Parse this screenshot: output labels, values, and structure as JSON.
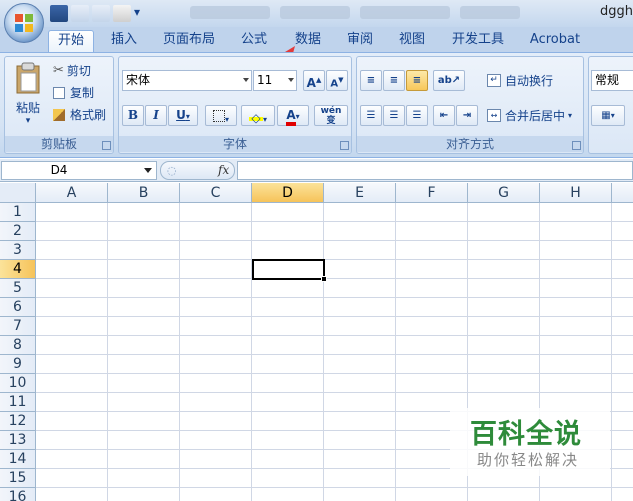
{
  "window": {
    "title_fragment": "dggh"
  },
  "tabs": [
    "开始",
    "插入",
    "页面布局",
    "公式",
    "数据",
    "审阅",
    "视图",
    "开发工具",
    "Acrobat"
  ],
  "active_tab": "开始",
  "clipboard": {
    "paste": "粘贴",
    "cut": "剪切",
    "copy": "复制",
    "format_painter": "格式刷",
    "label": "剪贴板"
  },
  "font": {
    "name": "宋体",
    "size": "11",
    "bold": "B",
    "italic": "I",
    "underline": "U",
    "label": "字体",
    "grow": "A",
    "shrink": "A",
    "wen": "wén",
    "zi": "变"
  },
  "alignment": {
    "wrap_text": "自动换行",
    "merge_center": "合并后居中",
    "label": "对齐方式"
  },
  "number": {
    "format": "常规"
  },
  "formula_bar": {
    "name_box": "D4",
    "fx": "fx",
    "value": ""
  },
  "columns": [
    "A",
    "B",
    "C",
    "D",
    "E",
    "F",
    "G",
    "H"
  ],
  "rows": [
    "1",
    "2",
    "3",
    "4",
    "5",
    "6",
    "7",
    "8",
    "9",
    "10",
    "11",
    "12",
    "13",
    "14",
    "15",
    "16"
  ],
  "selected_cell": {
    "column": "D",
    "row": "4"
  },
  "watermark": {
    "title": "百科全说",
    "subtitle": "助你轻松解决"
  },
  "colors": {
    "accent": "#15428b",
    "selection": "#f6c35a",
    "watermark_green": "#2e8b3a",
    "arrow": "#e33b3b"
  }
}
